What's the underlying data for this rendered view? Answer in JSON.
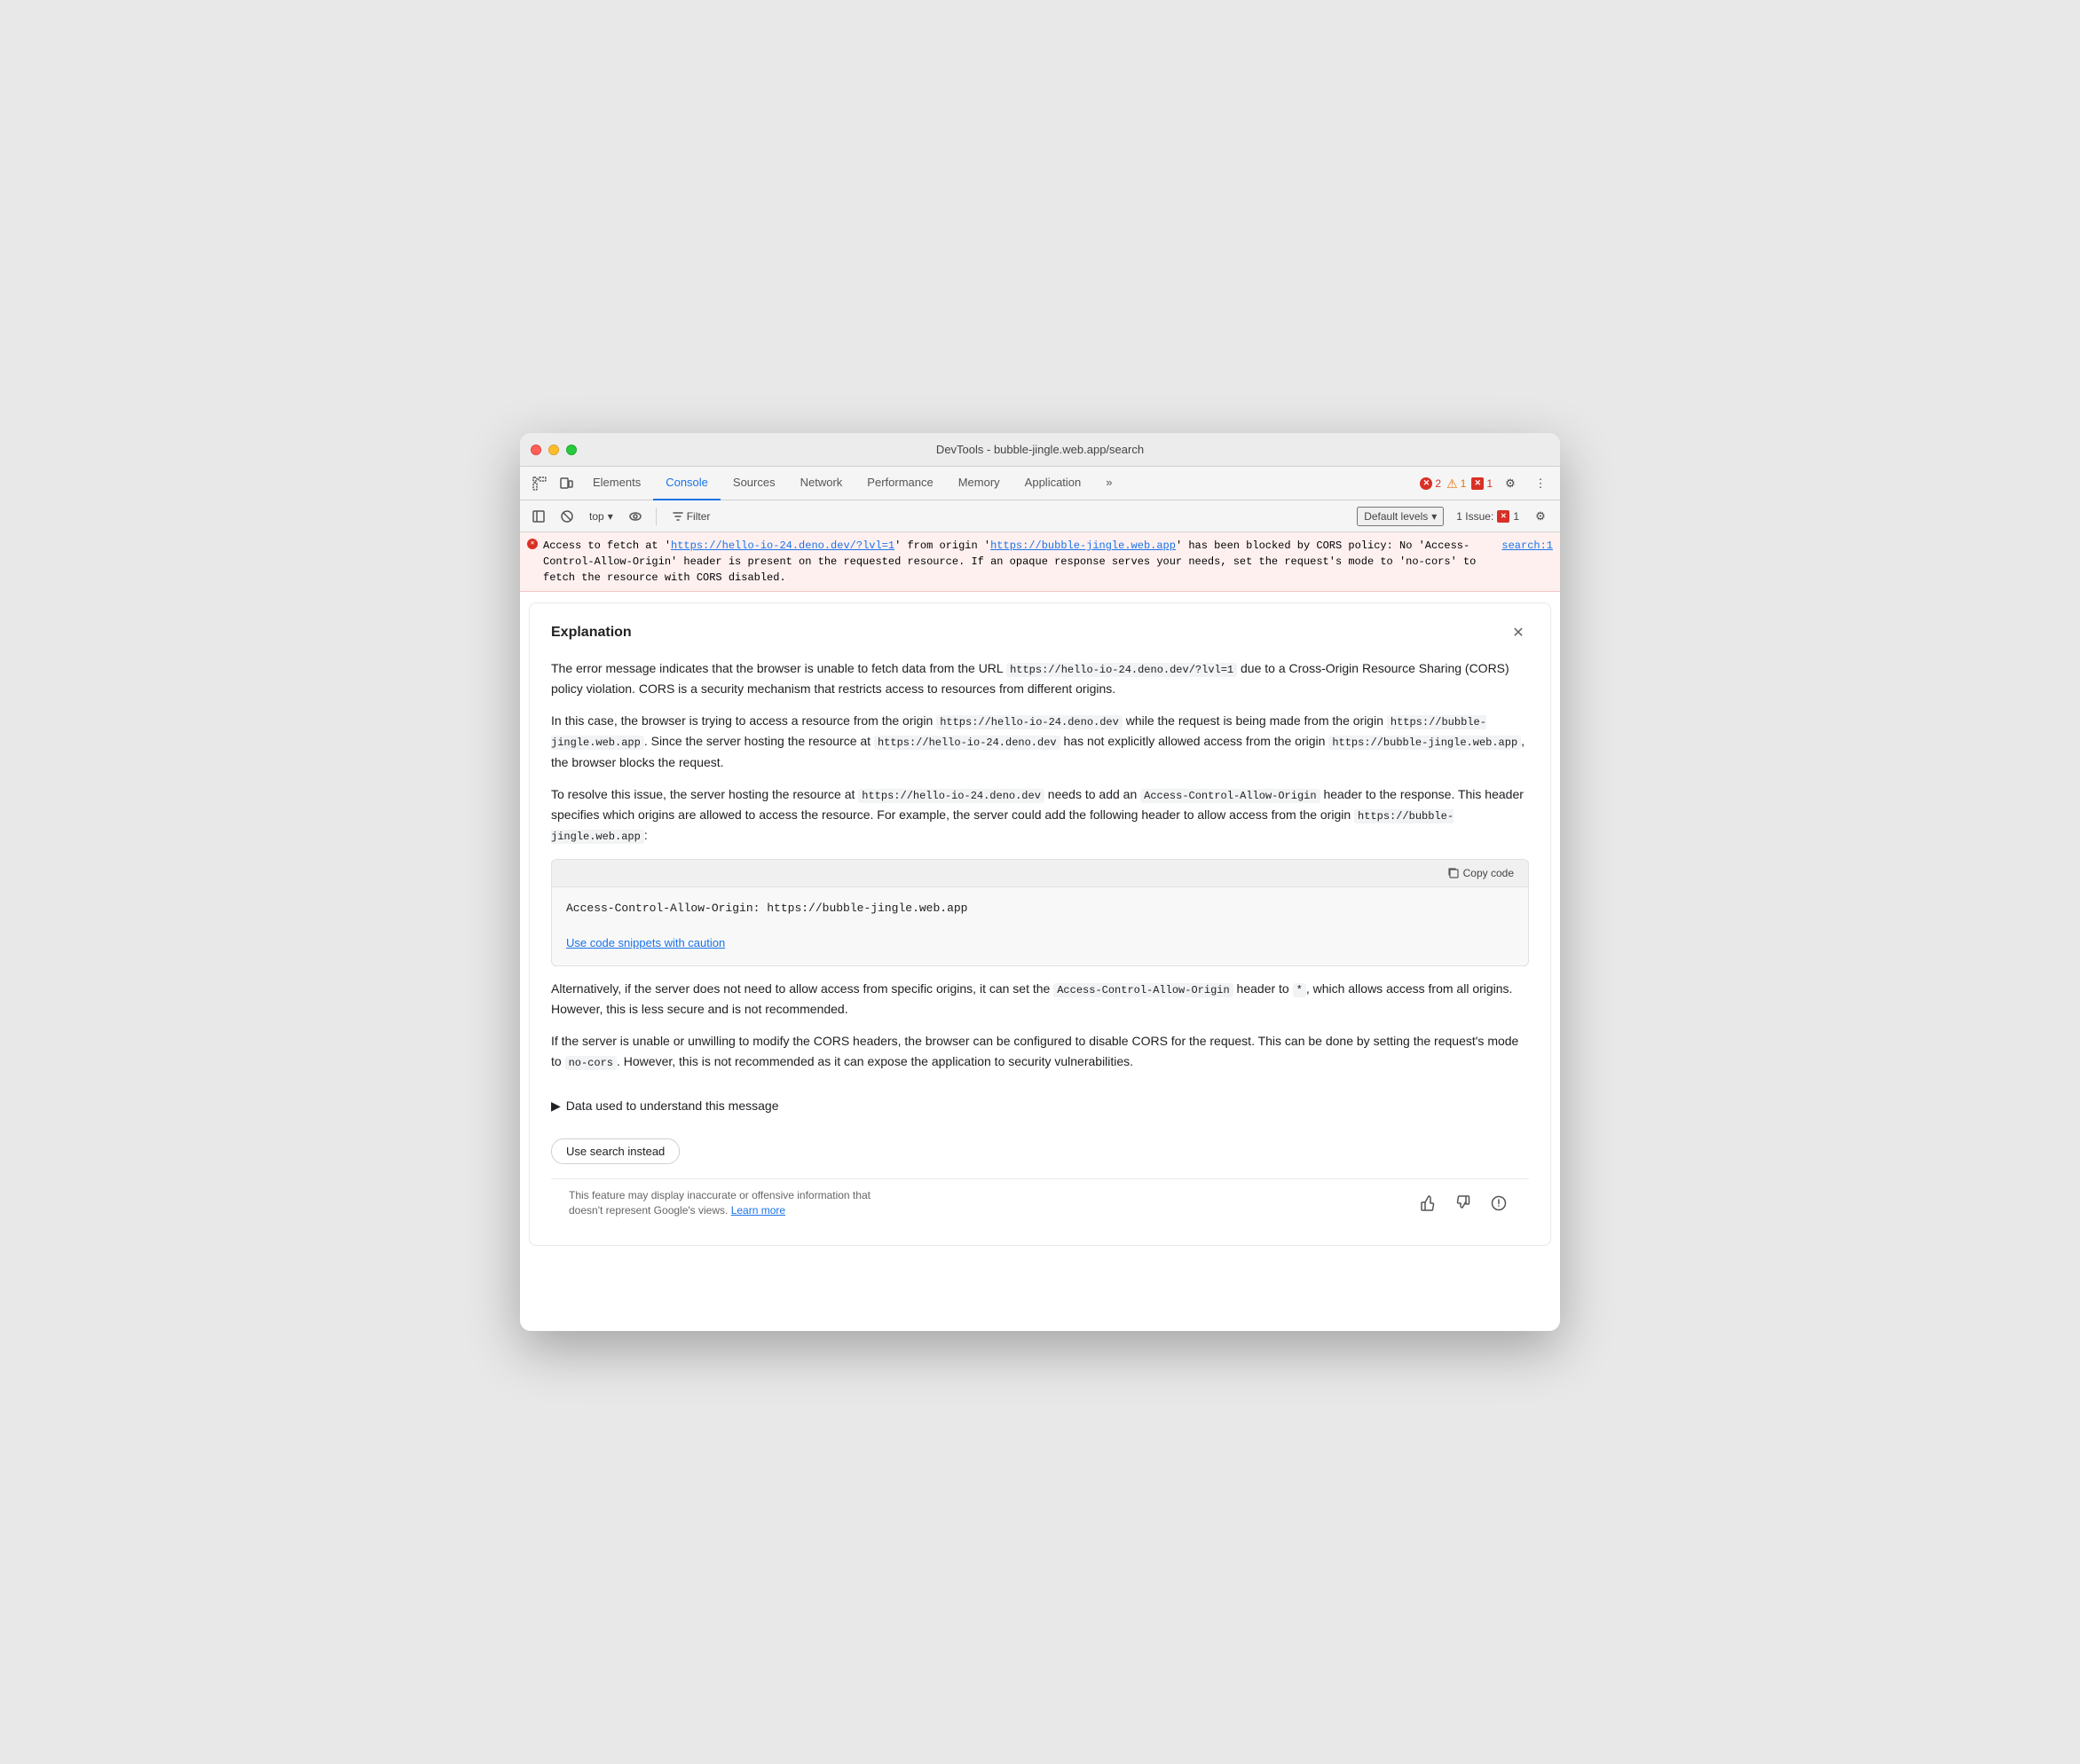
{
  "window": {
    "title": "DevTools - bubble-jingle.web.app/search"
  },
  "tabs": [
    {
      "id": "elements",
      "label": "Elements",
      "active": false
    },
    {
      "id": "console",
      "label": "Console",
      "active": true
    },
    {
      "id": "sources",
      "label": "Sources",
      "active": false
    },
    {
      "id": "network",
      "label": "Network",
      "active": false
    },
    {
      "id": "performance",
      "label": "Performance",
      "active": false
    },
    {
      "id": "memory",
      "label": "Memory",
      "active": false
    },
    {
      "id": "application",
      "label": "Application",
      "active": false
    }
  ],
  "toolbar_right": {
    "error_count": "2",
    "warning_count": "1",
    "issue_count": "1"
  },
  "secondary_toolbar": {
    "top_label": "top",
    "filter_label": "Filter",
    "default_levels_label": "Default levels",
    "issues_label": "1 Issue:",
    "chevron": "▾"
  },
  "error_message": {
    "prefix": "Access to fetch at '",
    "url1": "https://hello-io-24.deno.dev/?lvl=1",
    "middle": "' from origin '",
    "url2": "https://bubble-jingle.web.app",
    "suffix": "' has been blocked by CORS policy: No 'Access-Control-Allow-Origin' header is present on the requested resource. If an opaque response serves your needs, set the request's mode to 'no-cors' to fetch the resource with CORS disabled.",
    "source": "search:1"
  },
  "explanation": {
    "title": "Explanation",
    "para1": "The error message indicates that the browser is unable to fetch data from the URL https://hello-io-24.deno.dev/?lvl=1 due to a Cross-Origin Resource Sharing (CORS) policy violation. CORS is a security mechanism that restricts access to resources from different origins.",
    "para2_prefix": "In this case, the browser is trying to access a resource from the origin ",
    "para2_code1": "https://hello-io-24.deno.dev",
    "para2_mid": " while the request is being made from the origin ",
    "para2_code2": "https://bubble-jingle.web.app",
    "para2_mid2": ". Since the server hosting the resource at ",
    "para2_code3": "https://hello-io-24.deno.dev",
    "para2_suffix": " has not explicitly allowed access from the origin ",
    "para2_code4": "https://bubble-jingle.web.app",
    "para2_end": ", the browser blocks the request.",
    "para3_prefix": "To resolve this issue, the server hosting the resource at ",
    "para3_code1": "https://hello-io-24.deno.dev",
    "para3_mid": " needs to add an ",
    "para3_code2": "Access-Control-Allow-Origin",
    "para3_mid2": " header to the response. This header specifies which origins are allowed to access the resource. For example, the server could add the following header to allow access from the origin ",
    "para3_code3": "https://bubble-jingle.web.app",
    "para3_end": ":",
    "code_snippet": "Access-Control-Allow-Origin: https://bubble-jingle.web.app",
    "caution_link": "Use code snippets with caution",
    "copy_label": "Copy code",
    "para4_prefix": "Alternatively, if the server does not need to allow access from specific origins, it can set the ",
    "para4_code1": "Access-Control-Allow-Origin",
    "para4_mid": " header to ",
    "para4_code2": "*",
    "para4_end": ", which allows access from all origins. However, this is less secure and is not recommended.",
    "para5_prefix": "If the server is unable or unwilling to modify the CORS headers, the browser can be configured to disable CORS for the request. This can be done by setting the request's mode to ",
    "para5_code1": "no-cors",
    "para5_end": ". However, this is not recommended as it can expose the application to security vulnerabilities.",
    "data_used_label": "Data used to understand this message",
    "use_search_label": "Use search instead",
    "footer_text": "This feature may display inaccurate or offensive information that doesn't represent Google's views.",
    "learn_more_label": "Learn more"
  }
}
